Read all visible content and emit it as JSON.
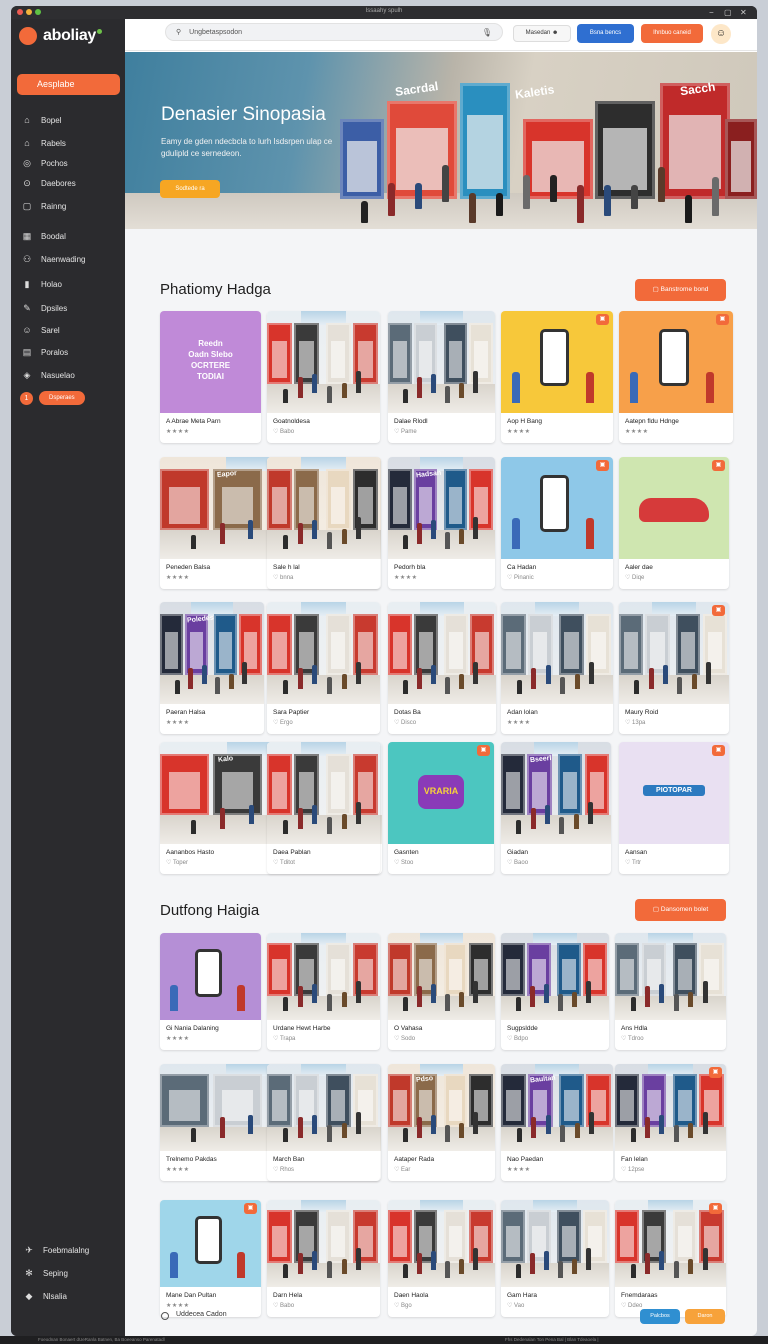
{
  "window": {
    "title": "Issaahy spulh"
  },
  "brand": {
    "name_main": "aboliay",
    "accent": "#f26a3a"
  },
  "sidebar": {
    "cta_label": "Aesplabe",
    "items": [
      {
        "icon": "home-icon",
        "glyph": "⌂",
        "label": "Bopel"
      },
      {
        "icon": "lock-icon",
        "glyph": "⌂",
        "label": "Rabels"
      },
      {
        "icon": "target-icon",
        "glyph": "◎",
        "label": "Pochos"
      },
      {
        "icon": "settings-icon",
        "glyph": "⊙",
        "label": "Daebores"
      },
      {
        "icon": "document-icon",
        "glyph": "▢",
        "label": "Rainng"
      },
      {
        "icon": "grid-icon",
        "glyph": "▦",
        "label": "Boodal"
      },
      {
        "icon": "share-icon",
        "glyph": "⚇",
        "label": "Naenwading"
      },
      {
        "icon": "file-icon",
        "glyph": "▮",
        "label": "Holao"
      },
      {
        "icon": "pen-icon",
        "glyph": "✎",
        "label": "Dpsiles"
      },
      {
        "icon": "user-icon",
        "glyph": "☺",
        "label": "Sarel"
      },
      {
        "icon": "list-icon",
        "glyph": "▤",
        "label": "Poralos"
      },
      {
        "icon": "tag-icon",
        "glyph": "◈",
        "label": "Nasuelao"
      }
    ],
    "badge_count": "1",
    "badge_label": "Dsperaes",
    "bottom_items": [
      {
        "icon": "tool-icon",
        "glyph": "✈",
        "label": "Foebmalalng"
      },
      {
        "icon": "gear-icon",
        "glyph": "✻",
        "label": "Seping"
      },
      {
        "icon": "flag-icon",
        "glyph": "◆",
        "label": "Nlsalia"
      }
    ]
  },
  "topbar": {
    "search_placeholder": "Ungbetaspsodon",
    "messages_label": "Masedan",
    "blue_button": "Bsna bencs",
    "orange_button": "Ihnbuo caneid"
  },
  "hero": {
    "title": "Denasier Sinopasia",
    "description": "Eamy de gden ndecbcla to lurh Isdsrpen ulap ce gdulipld ce sernedeon.",
    "button": "Sodtede ra",
    "store_signs": [
      "Sacrdal",
      "Kaletis",
      "Sacch"
    ]
  },
  "section1": {
    "title": "Phatiomy Hadga",
    "button": "Banstrome bond",
    "rows": [
      [
        {
          "title": "A Abrae Meta Parn",
          "sub": "★★★★",
          "stars": true,
          "art": "promo-purple",
          "art_text": "Reedn\nOadn Slebo\nOCRTERE\nTODIAI"
        },
        {
          "title": "Goatnoldesa",
          "sub": "♡ Babo",
          "stars": false,
          "art": "mall-red"
        },
        {
          "title": "Dalae Rlodl",
          "sub": "♡ Pame",
          "stars": false,
          "art": "mall-grey"
        },
        {
          "title": "Aop H Bang",
          "sub": "★★★★",
          "stars": true,
          "art": "illus-yellow",
          "badge": true
        },
        {
          "title": "Aatepn fldu Hdnge",
          "sub": "★★★★",
          "stars": true,
          "art": "illus-orange",
          "badge": true
        }
      ],
      [
        {
          "title": "Peneden Balsa",
          "sub": "★★★★",
          "stars": true,
          "art": "mall-warm",
          "sign": "Eapor"
        },
        {
          "title": "Sale h lal",
          "sub": "♡ bnna",
          "stars": false,
          "art": "mall-warm"
        },
        {
          "title": "Pedorh bla",
          "sub": "★★★★",
          "stars": true,
          "art": "mall-dark",
          "sign": "Hadsan"
        },
        {
          "title": "Ca Hadan",
          "sub": "♡ Pinanic",
          "stars": false,
          "art": "illus-blue",
          "badge": true
        },
        {
          "title": "Aaler dae",
          "sub": "♡ Diqe",
          "stars": false,
          "art": "illus-green",
          "badge": true
        }
      ],
      [
        {
          "title": "Paeran Halsa",
          "sub": "★★★★",
          "stars": true,
          "art": "mall-dark",
          "sign": "Poledes"
        },
        {
          "title": "Sara Paptier",
          "sub": "♡ Ergo",
          "stars": false,
          "art": "mall-red"
        },
        {
          "title": "Dotas Ba",
          "sub": "♡ Disco",
          "stars": false,
          "art": "mall-red"
        },
        {
          "title": "Adan lolan",
          "sub": "★★★★",
          "stars": true,
          "art": "mall-grey"
        },
        {
          "title": "Maury Roid",
          "sub": "♡ 13pa",
          "stars": false,
          "art": "mall-grey",
          "badge": true
        }
      ],
      [
        {
          "title": "Aananbos Hasto",
          "sub": "♡ Toper",
          "stars": false,
          "art": "mall-red",
          "sign": "Kalo"
        },
        {
          "title": "Daea Pablan",
          "sub": "♡ Tditot",
          "stars": false,
          "art": "mall-red"
        },
        {
          "title": "Gasnten",
          "sub": "♡ Stoo",
          "stars": false,
          "art": "illus-teal",
          "art_text": "VRARIA",
          "badge": true
        },
        {
          "title": "Giadan",
          "sub": "♡ Baoo",
          "stars": false,
          "art": "mall-dark",
          "sign": "Bseerl"
        },
        {
          "title": "Aansan",
          "sub": "♡ Trtr",
          "stars": false,
          "art": "illus-lilac",
          "art_text": "PIOTOPAR",
          "badge": true
        }
      ]
    ]
  },
  "section2": {
    "title": "Dutfong Haigia",
    "button": "Dansomen bolet",
    "rows": [
      [
        {
          "title": "Gi Nania Dalaning",
          "sub": "★★★★",
          "stars": true,
          "art": "illus-purple"
        },
        {
          "title": "Urdane Hewt Harbe",
          "sub": "♡ Trapa",
          "stars": false,
          "art": "mall-red"
        },
        {
          "title": "O Vahasa",
          "sub": "♡ Sodo",
          "stars": false,
          "art": "mall-warm"
        },
        {
          "title": "Sugpsldde",
          "sub": "♡ Bdpo",
          "stars": false,
          "art": "mall-dark"
        },
        {
          "title": "Ans Hdla",
          "sub": "♡ Tdroo",
          "stars": false,
          "art": "mall-grey"
        }
      ],
      [
        {
          "title": "Trelnemo Pakdas",
          "sub": "★★★★",
          "stars": true,
          "art": "mall-grey"
        },
        {
          "title": "March Ban",
          "sub": "♡ Rhos",
          "stars": false,
          "art": "mall-grey"
        },
        {
          "title": "Aataper Rada",
          "sub": "♡ Ear",
          "stars": false,
          "art": "mall-warm",
          "sign": "Pdso"
        },
        {
          "title": "Nao Paedan",
          "sub": "★★★★",
          "stars": true,
          "art": "mall-dark",
          "sign": "Baultan"
        },
        {
          "title": "Fan lelan",
          "sub": "♡ 12pse",
          "stars": false,
          "art": "mall-dark",
          "badge": true
        }
      ],
      [
        {
          "title": "Mane Dan Pultan",
          "sub": "★★★★",
          "stars": true,
          "art": "illus-cyan",
          "badge": true
        },
        {
          "title": "Darn Hela",
          "sub": "♡ Babo",
          "stars": false,
          "art": "mall-red"
        },
        {
          "title": "Daen Haola",
          "sub": "♡ Bgo",
          "stars": false,
          "art": "mall-red"
        },
        {
          "title": "Gam Hara",
          "sub": "♡ Vao",
          "stars": false,
          "art": "mall-grey"
        },
        {
          "title": "Fnemdaraas",
          "sub": "♡ Ddeo",
          "stars": false,
          "art": "mall-red",
          "badge": true
        }
      ]
    ]
  },
  "footer": {
    "radio_label": "Uddecea Cadon",
    "blue_button": "Palcbos",
    "orange_button": "Daron"
  },
  "statusbar": {
    "left": "Foeodnan Bonaert dUeRanla Batnen, Ba Boeeanso Parenatadl",
    "right": "Fhs Dedenalan Ton Pena Bal | Blan Tdeaoela |"
  }
}
